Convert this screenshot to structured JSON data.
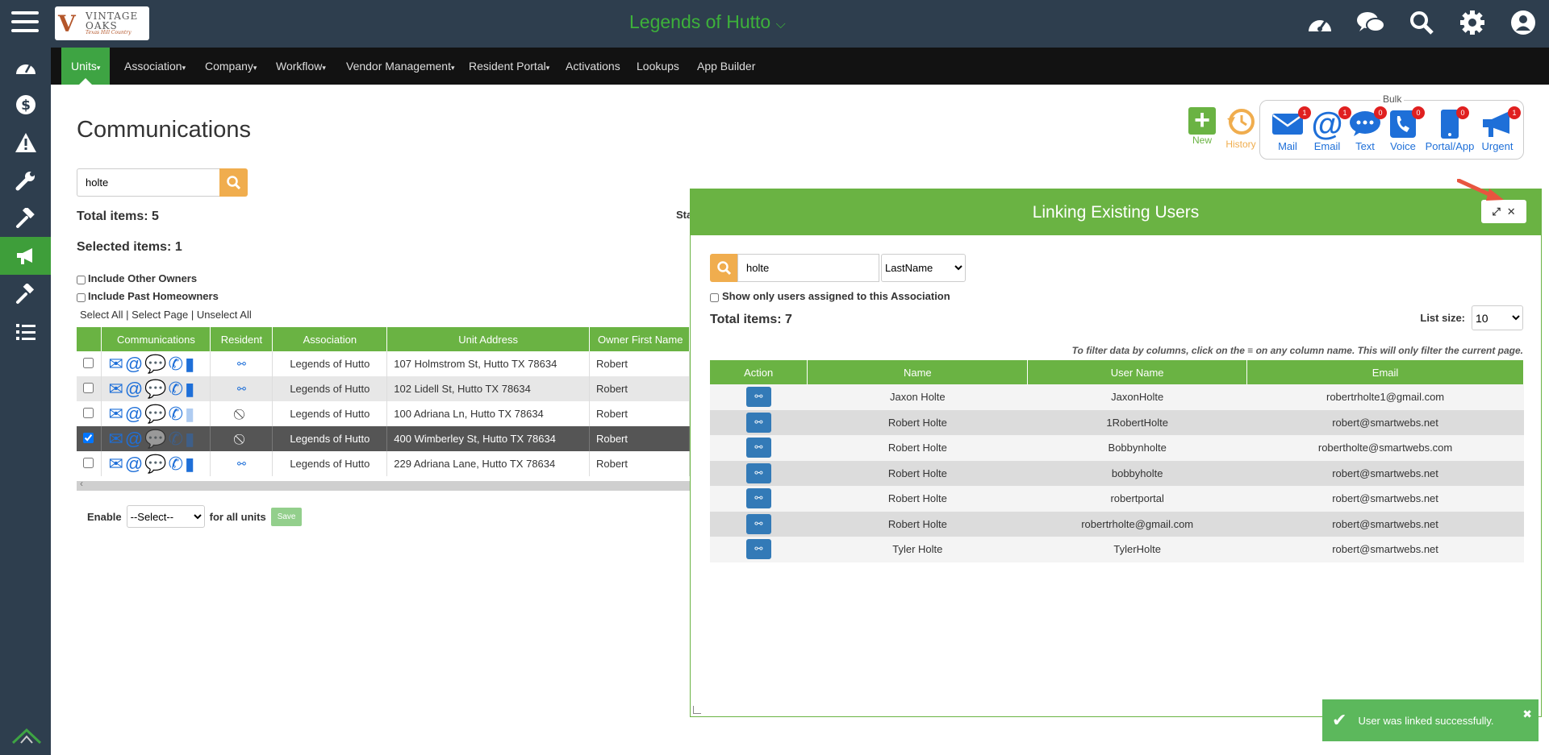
{
  "header": {
    "association_title": "Legends of Hutto",
    "logo": {
      "line1": "VINTAGE",
      "line2": "OAKS",
      "line3": "Texas Hill Country"
    }
  },
  "top_icons": [
    "dashboard-icon",
    "chat-icon",
    "search-icon",
    "gear-icon",
    "user-icon"
  ],
  "menu": [
    {
      "label": "Units",
      "caret": true,
      "active": true
    },
    {
      "label": "Association",
      "caret": true
    },
    {
      "label": "Company",
      "caret": true
    },
    {
      "label": "Workflow",
      "caret": true
    },
    {
      "label": "Vendor Management",
      "caret": true
    },
    {
      "label": "Resident Portal",
      "caret": true
    },
    {
      "label": "Activations"
    },
    {
      "label": "Lookups"
    },
    {
      "label": "App Builder"
    }
  ],
  "page": {
    "title": "Communications",
    "search_value": "holte",
    "total_items": "Total items: 5",
    "selected_items": "Selected items: 1",
    "include_other_owners": "Include Other Owners",
    "include_past_homeowners": "Include Past Homeowners",
    "select_all": "Select All",
    "select_page": "Select Page",
    "unselect_all": "Unselect All",
    "status_cut": "Sta",
    "enable_label": "Enable",
    "enable_select": "--Select--",
    "for_all_units": "for all units",
    "save": "Save"
  },
  "unit_table": {
    "columns": [
      "Communications",
      "Resident",
      "Association",
      "Unit Address",
      "Owner First Name"
    ],
    "rows": [
      {
        "checked": false,
        "resident": "link",
        "association": "Legends of Hutto",
        "address": "107 Holmstrom St, Hutto TX 78634",
        "owner": "Robert"
      },
      {
        "checked": false,
        "resident": "link",
        "association": "Legends of Hutto",
        "address": "102 Lidell St, Hutto TX 78634",
        "owner": "Robert"
      },
      {
        "checked": false,
        "resident": "none",
        "association": "Legends of Hutto",
        "address": "100 Adriana Ln, Hutto TX 78634",
        "owner": "Robert"
      },
      {
        "checked": true,
        "resident": "none",
        "association": "Legends of Hutto",
        "address": "400 Wimberley St, Hutto TX 78634",
        "owner": "Robert"
      },
      {
        "checked": false,
        "resident": "link",
        "association": "Legends of Hutto",
        "address": "229 Adriana Lane, Hutto TX 78634",
        "owner": "Robert"
      }
    ]
  },
  "actions": {
    "new": "New",
    "history": "History"
  },
  "bulk": {
    "label": "Bulk",
    "items": [
      {
        "label": "Mail",
        "badge": "1"
      },
      {
        "label": "Email",
        "badge": "1"
      },
      {
        "label": "Text",
        "badge": "0"
      },
      {
        "label": "Voice",
        "badge": "0"
      },
      {
        "label": "Portal/App",
        "badge": "0"
      },
      {
        "label": "Urgent",
        "badge": "1"
      }
    ]
  },
  "modal": {
    "title": "Linking Existing Users",
    "search_value": "holte",
    "search_field": "LastName",
    "show_only_assigned": "Show only users assigned to this Association",
    "total_items": "Total items: 7",
    "list_size_label": "List size:",
    "list_size_value": "10",
    "hint": "To filter data by columns, click on the ≡ on any column name. This will only filter the current page.",
    "columns": [
      "Action",
      "Name",
      "User Name",
      "Email"
    ],
    "rows": [
      {
        "name": "Jaxon Holte",
        "username": "JaxonHolte",
        "email": "robertrholte1@gmail.com"
      },
      {
        "name": "Robert Holte",
        "username": "1RobertHolte",
        "email": "robert@smartwebs.net"
      },
      {
        "name": "Robert Holte",
        "username": "Bobbynholte",
        "email": "robertholte@smartwebs.com"
      },
      {
        "name": "Robert Holte",
        "username": "bobbyholte",
        "email": "robert@smartwebs.net"
      },
      {
        "name": "Robert Holte",
        "username": "robertportal",
        "email": "robert@smartwebs.net"
      },
      {
        "name": "Robert Holte",
        "username": "robertrholte@gmail.com",
        "email": "robert@smartwebs.net"
      },
      {
        "name": "Tyler Holte",
        "username": "TylerHolte",
        "email": "robert@smartwebs.net"
      }
    ]
  },
  "toast": {
    "message": "User was linked successfully."
  },
  "colors": {
    "green": "#6ab343",
    "navy": "#2e3e4e",
    "orange": "#f0ad4e",
    "blue": "#1e6fd8",
    "title_green": "#3db13a"
  }
}
